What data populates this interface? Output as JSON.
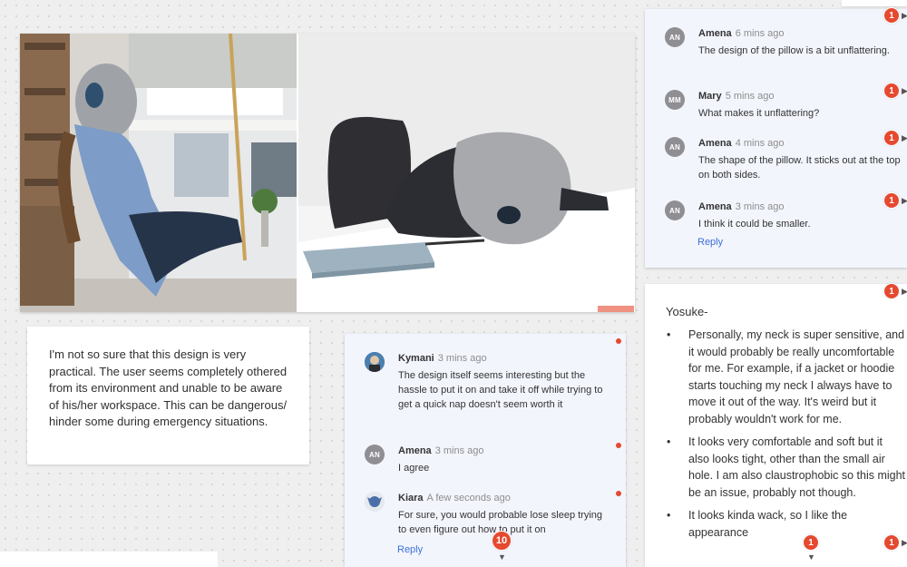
{
  "note": {
    "text": "I'm not so sure that this design is very practical. The user seems completely othered from its environment and unable to be aware of his/her workspace. This can be dangerous/ hinder some during emergency situations."
  },
  "thread_mid": {
    "comments": [
      {
        "initials": "",
        "author": "Kymani",
        "time": "3 mins ago",
        "text": "The design itself seems interesting but the hassle to put it on and take it off while trying to get a quick nap doesn't seem worth it"
      },
      {
        "initials": "AN",
        "author": "Amena",
        "time": "3 mins ago",
        "text": "I agree"
      },
      {
        "initials": "",
        "author": "Kiara",
        "time": "A few seconds ago",
        "text": "For sure, you would probable lose sleep trying to even figure out how to put it on"
      }
    ],
    "reply_label": "Reply",
    "badge_count": "10"
  },
  "thread_top": {
    "comments": [
      {
        "initials": "AN",
        "author": "Amena",
        "time": "6 mins ago",
        "text": "The design of the pillow is a bit unflattering."
      },
      {
        "initials": "MM",
        "author": "Mary",
        "time": "5 mins ago",
        "text": "What makes it unflattering?"
      },
      {
        "initials": "AN",
        "author": "Amena",
        "time": "4 mins ago",
        "text": "The shape of the pillow. It sticks out at the top on both sides."
      },
      {
        "initials": "AN",
        "author": "Amena",
        "time": "3 mins ago",
        "text": "I think it could be smaller."
      }
    ],
    "reply_label": "Reply"
  },
  "bullets": {
    "heading": "Yosuke-",
    "items": [
      "Personally, my neck is super sensitive, and it would probably be really uncomfortable for me. For example, if a jacket or hoodie starts touching my neck I always have to move it out of the way. It's weird but it probably wouldn't work for me.",
      "It looks very comfortable and soft but it also looks tight, other than the small air hole. I am also claustrophobic so this might be an issue, probably not though.",
      "It looks kinda wack, so I like the appearance"
    ],
    "bullet_char": "•"
  },
  "badges": {
    "one": "1",
    "caret_right": "▶",
    "caret_down": "▼"
  },
  "colors": {
    "accent_red": "#e5492f",
    "link_blue": "#3d6fd6",
    "thread_bg": "#f3f5fd"
  }
}
